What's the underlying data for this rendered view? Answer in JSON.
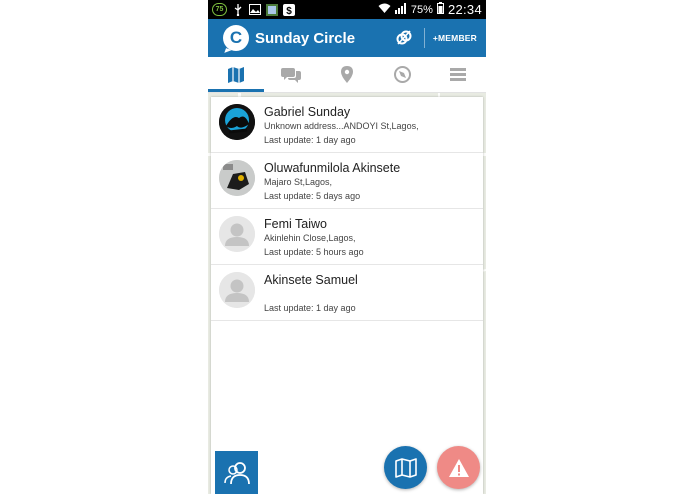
{
  "status_bar": {
    "badge": "75",
    "battery": "75%",
    "time": "22:34"
  },
  "app_bar": {
    "logo_letter": "C",
    "title": "Sunday Circle",
    "member_label": "+MEMBER"
  },
  "tabs": [
    {
      "icon": "map-icon",
      "active": true
    },
    {
      "icon": "chat-icon",
      "active": false
    },
    {
      "icon": "location-pin-icon",
      "active": false
    },
    {
      "icon": "compass-icon",
      "active": false
    },
    {
      "icon": "menu-icon",
      "active": false
    }
  ],
  "members": [
    {
      "name": "Gabriel Sunday",
      "address": "Unknown address...ANDOYI St,Lagos,",
      "last_update": "Last update: 1 day ago",
      "avatar": "photo"
    },
    {
      "name": "Oluwafunmilola Akinsete",
      "address": "Majaro St,Lagos,",
      "last_update": "Last update: 5 days ago",
      "avatar": "photo"
    },
    {
      "name": "Femi Taiwo",
      "address": "Akinlehin Close,Lagos,",
      "last_update": "Last update: 5 hours ago",
      "avatar": "placeholder"
    },
    {
      "name": "Akinsete Samuel",
      "address": "",
      "last_update": "Last update: 1 day ago",
      "avatar": "placeholder"
    }
  ],
  "colors": {
    "primary": "#1a72b0",
    "alert": "#ef8a86",
    "status_bar": "#000000"
  }
}
